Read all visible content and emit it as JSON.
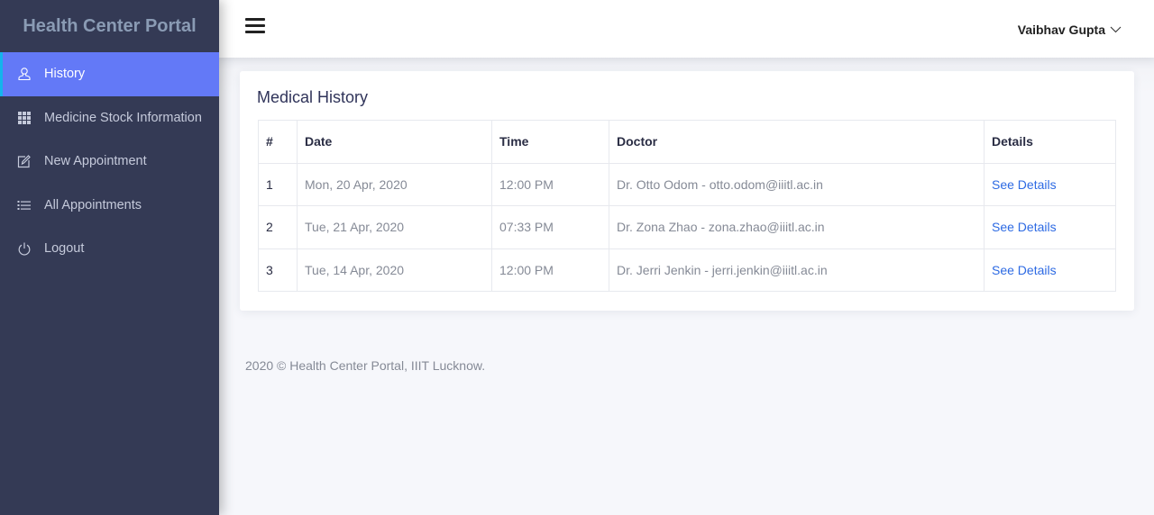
{
  "sidebar": {
    "brand": "Health Center Portal",
    "items": [
      {
        "label": "History",
        "icon": "user-icon",
        "active": true
      },
      {
        "label": "Medicine Stock Information",
        "icon": "grid-icon",
        "active": false
      },
      {
        "label": "New Appointment",
        "icon": "edit-icon",
        "active": false
      },
      {
        "label": "All Appointments",
        "icon": "list-icon",
        "active": false
      },
      {
        "label": "Logout",
        "icon": "power-icon",
        "active": false
      }
    ]
  },
  "topbar": {
    "menu_icon": "hamburger-icon",
    "user_name": "Vaibhav Gupta",
    "user_menu_icon": "chevron-down-icon"
  },
  "card": {
    "title": "Medical History",
    "table": {
      "headers": [
        "#",
        "Date",
        "Time",
        "Doctor",
        "Details"
      ],
      "rows": [
        {
          "num": "1",
          "date": "Mon, 20 Apr, 2020",
          "time": "12:00 PM",
          "doctor": "Dr. Otto Odom - otto.odom@iiitl.ac.in",
          "details": "See Details"
        },
        {
          "num": "2",
          "date": "Tue, 21 Apr, 2020",
          "time": "07:33 PM",
          "doctor": "Dr. Zona Zhao - zona.zhao@iiitl.ac.in",
          "details": "See Details"
        },
        {
          "num": "3",
          "date": "Tue, 14 Apr, 2020",
          "time": "12:00 PM",
          "doctor": "Dr. Jerri Jenkin - jerri.jenkin@iiitl.ac.in",
          "details": "See Details"
        }
      ]
    }
  },
  "footer": {
    "text": "2020 © Health Center Portal, IIIT Lucknow."
  },
  "colors": {
    "sidebar_bg": "#343a55",
    "active_item_bg": "#6379f7",
    "active_item_border": "#14b4ec",
    "link": "#2d6ae3"
  }
}
